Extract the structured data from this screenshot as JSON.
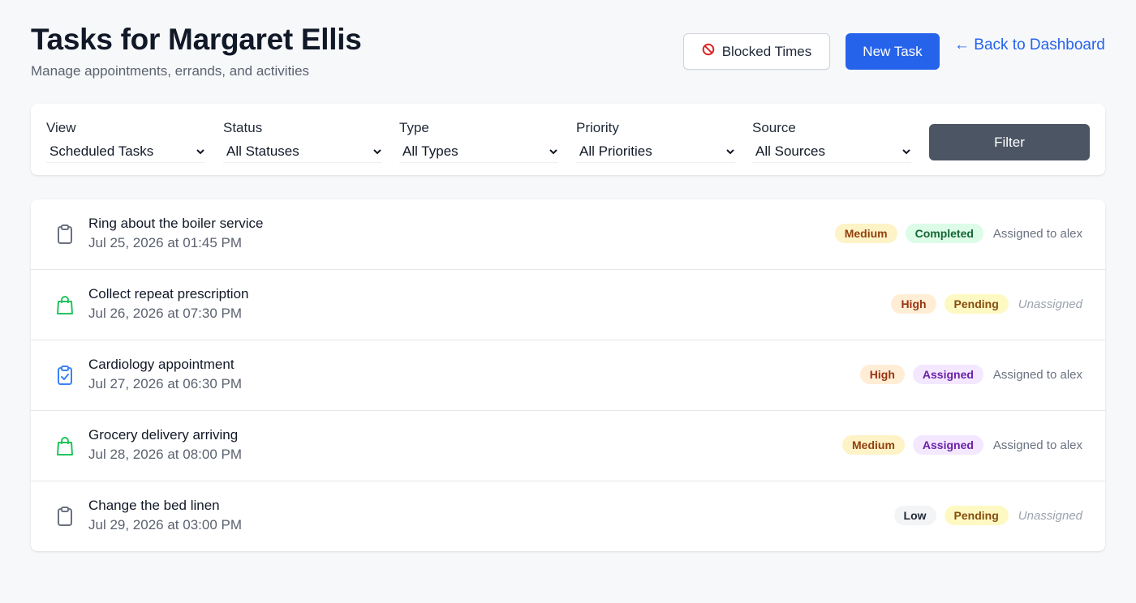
{
  "header": {
    "title": "Tasks for Margaret Ellis",
    "subtitle": "Manage appointments, errands, and activities",
    "blocked_times_label": "Blocked Times",
    "new_task_label": "New Task",
    "back_label": "← Back to Dashboard"
  },
  "filters": {
    "view": {
      "label": "View",
      "value": "Scheduled Tasks"
    },
    "status": {
      "label": "Status",
      "value": "All Statuses"
    },
    "type": {
      "label": "Type",
      "value": "All Types"
    },
    "priority": {
      "label": "Priority",
      "value": "All Priorities"
    },
    "source": {
      "label": "Source",
      "value": "All Sources"
    },
    "button_label": "Filter"
  },
  "tasks": [
    {
      "icon": "clipboard-icon",
      "title": "Ring about the boiler service",
      "datetime": "Jul 25, 2026 at 01:45 PM",
      "priority": "Medium",
      "status": "Completed",
      "assignee": "Assigned to alex"
    },
    {
      "icon": "shopping-bag-icon",
      "title": "Collect repeat prescription",
      "datetime": "Jul 26, 2026 at 07:30 PM",
      "priority": "High",
      "status": "Pending",
      "assignee": "Unassigned"
    },
    {
      "icon": "clipboard-check-icon",
      "title": "Cardiology appointment",
      "datetime": "Jul 27, 2026 at 06:30 PM",
      "priority": "High",
      "status": "Assigned",
      "assignee": "Assigned to alex"
    },
    {
      "icon": "shopping-bag-icon",
      "title": "Grocery delivery arriving",
      "datetime": "Jul 28, 2026 at 08:00 PM",
      "priority": "Medium",
      "status": "Assigned",
      "assignee": "Assigned to alex"
    },
    {
      "icon": "clipboard-icon",
      "title": "Change the bed linen",
      "datetime": "Jul 29, 2026 at 03:00 PM",
      "priority": "Low",
      "status": "Pending",
      "assignee": "Unassigned"
    }
  ],
  "colors": {
    "primary": "#2563eb",
    "filter_button": "#4b5563",
    "errand_icon": "#22c55e",
    "appointment_icon": "#3b82f6",
    "chore_icon": "#6b7280",
    "blocked_icon": "#dc2626"
  }
}
